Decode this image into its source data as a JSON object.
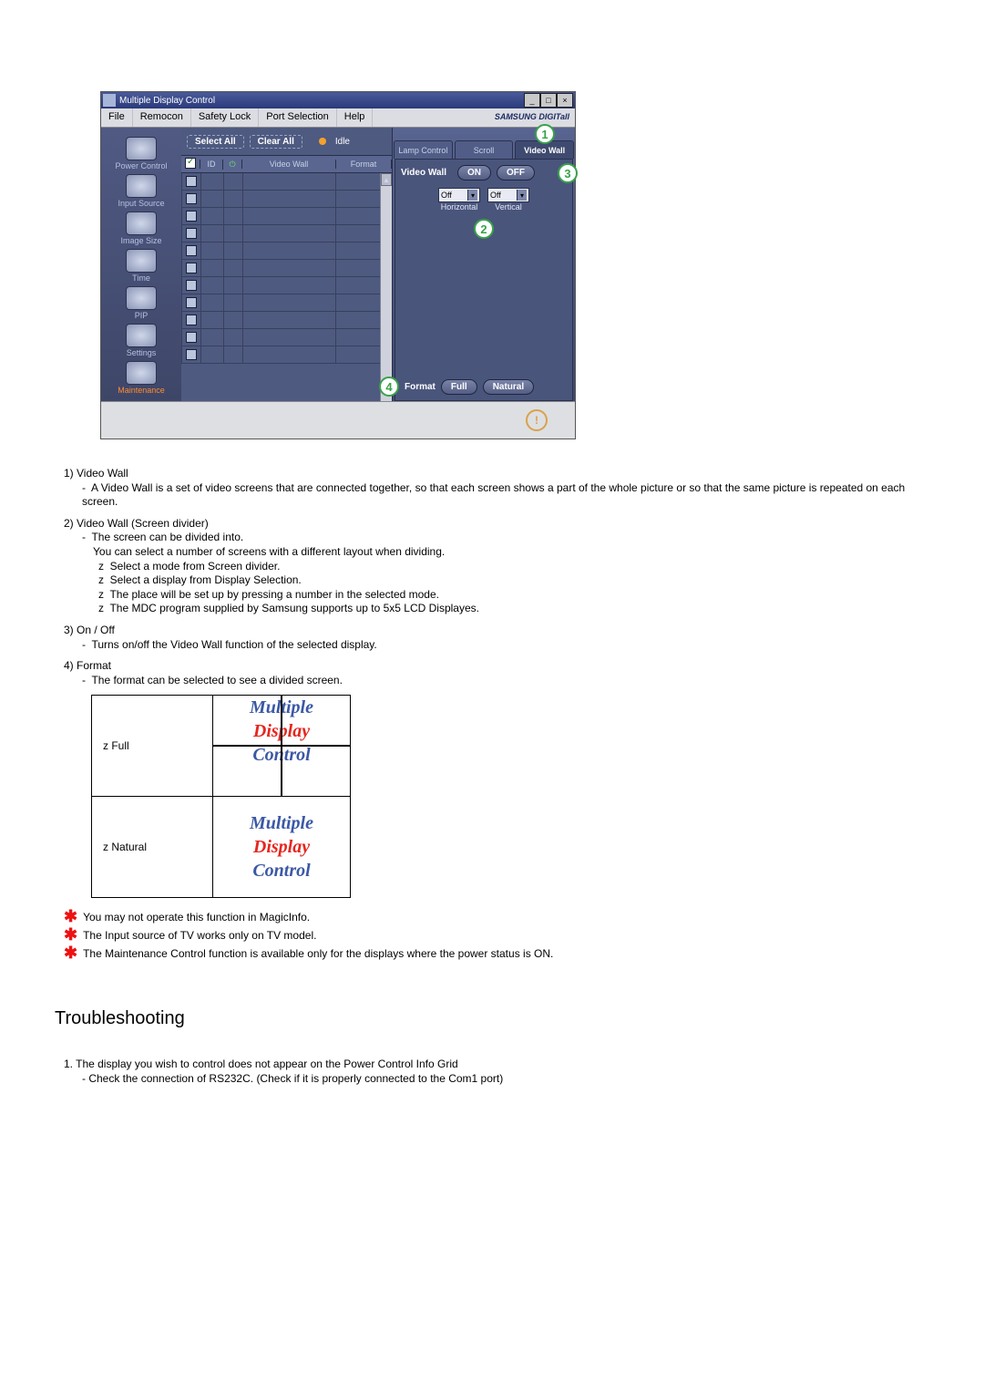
{
  "window": {
    "title": "Multiple Display Control",
    "min": "_",
    "max": "□",
    "close": "×"
  },
  "menu": {
    "file": "File",
    "remocon": "Remocon",
    "safety_lock": "Safety Lock",
    "port_selection": "Port Selection",
    "help": "Help",
    "brand": "SAMSUNG DIGITall"
  },
  "sidebar": {
    "items": [
      {
        "label": "Power Control"
      },
      {
        "label": "Input Source"
      },
      {
        "label": "Image Size"
      },
      {
        "label": "Time"
      },
      {
        "label": "PIP"
      },
      {
        "label": "Settings"
      },
      {
        "label": "Maintenance"
      }
    ]
  },
  "toolbar": {
    "select_all": "Select All",
    "clear_all": "Clear All",
    "idle": "Idle"
  },
  "grid": {
    "headers": {
      "id": "ID",
      "video_wall": "Video Wall",
      "format": "Format"
    }
  },
  "tabs": {
    "lamp": "Lamp Control",
    "scroll": "Scroll",
    "video_wall": "Video Wall"
  },
  "panel": {
    "video_wall_label": "Video Wall",
    "on": "ON",
    "off": "OFF",
    "horizontal_label": "Horizontal",
    "vertical_label": "Vertical",
    "drop_value": "Off",
    "format_label": "Format",
    "full": "Full",
    "natural": "Natural"
  },
  "callouts": {
    "c1": "1",
    "c2": "2",
    "c3": "3",
    "c4": "4"
  },
  "status": {
    "warn": "!"
  },
  "explain": {
    "h1": "1)  Video Wall",
    "h1_l1": "A Video Wall is a set of video screens that are connected together, so that each screen shows a part of the whole picture or so that the same picture is repeated on each screen.",
    "h2": "2)  Video Wall (Screen divider)",
    "h2_l1": "The screen can be divided into.",
    "h2_l2": "You can select a number of screens with a different layout when dividing.",
    "h2_b1": "Select a mode from Screen divider.",
    "h2_b2": "Select a display from Display Selection.",
    "h2_b3": "The place will be set up by pressing a number in the selected mode.",
    "h2_b4": "The MDC program supplied by Samsung supports up to 5x5 LCD Displayes.",
    "h3": "3)  On / Off",
    "h3_l1": "Turns on/off the Video Wall function of the selected display.",
    "h4": "4)  Format",
    "h4_l1": "The format can be selected to see a divided screen.",
    "full_label": "z  Full",
    "natural_label": "z  Natural",
    "mdc_l1": "Multiple",
    "mdc_l2": "Display",
    "mdc_l3": "Control",
    "note1": "You may not operate this function in MagicInfo.",
    "note2": "The Input source of TV works only on TV model.",
    "note3": "The Maintenance Control function is available only for the displays where the power status is ON.",
    "troubleshooting": "Troubleshooting",
    "ts1": "1.  The display you wish to control does not appear on the Power Control Info Grid",
    "ts1_l1": "- Check the connection of RS232C. (Check if it is properly connected to the Com1 port)"
  }
}
